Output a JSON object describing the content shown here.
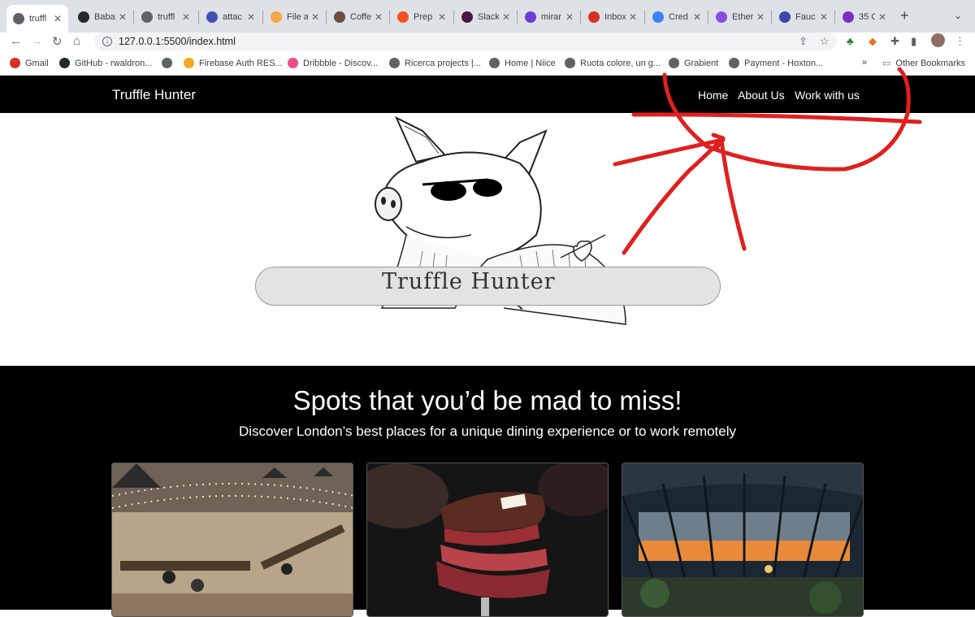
{
  "browser": {
    "tabs": [
      {
        "label": "truffl",
        "active": true,
        "color": "#5f6368"
      },
      {
        "label": "Baba",
        "color": "#24292e"
      },
      {
        "label": "truffl",
        "color": "#5f6368"
      },
      {
        "label": "attac",
        "color": "#3f51b5"
      },
      {
        "label": "File a",
        "color": "#f4a742"
      },
      {
        "label": "Coffe",
        "color": "#6d4c41"
      },
      {
        "label": "Prep",
        "color": "#f4511e"
      },
      {
        "label": "Slack",
        "color": "#4a154b"
      },
      {
        "label": "mirar",
        "color": "#6e3cd6"
      },
      {
        "label": "Inbox",
        "color": "#d93025"
      },
      {
        "label": "Cred",
        "color": "#3b82f6"
      },
      {
        "label": "Ether",
        "color": "#8a4ee6"
      },
      {
        "label": "Fauc",
        "color": "#3949ab"
      },
      {
        "label": "35 C",
        "color": "#7b2fbf"
      }
    ],
    "new_tab": "+",
    "url": "127.0.0.1:5500/index.html",
    "bookmarks": [
      {
        "label": "Gmail",
        "color": "#d93025"
      },
      {
        "label": "GitHub - rwaldron...",
        "color": "#24292e"
      },
      {
        "label": "",
        "color": "#5f6368"
      },
      {
        "label": "Firebase Auth RES...",
        "color": "#f6a623"
      },
      {
        "label": "Dribbble - Discov...",
        "color": "#ea4c89"
      },
      {
        "label": "Ricerca projects |...",
        "color": "#5f6368"
      },
      {
        "label": "Home | Niice",
        "color": "#5f6368"
      },
      {
        "label": "Ruota colore, un g...",
        "color": "#5f6368"
      },
      {
        "label": "Grabient",
        "color": "#5f6368"
      },
      {
        "label": "Payment - Hoxton...",
        "color": "#5f6368"
      }
    ],
    "bookmarks_overflow": "»",
    "other_bookmarks": "Other Bookmarks"
  },
  "site": {
    "brand": "Truffle Hunter",
    "nav": [
      "Home",
      "About Us",
      "Work with us"
    ],
    "hero_logo_text": "Truffle Hunter",
    "spots_title": "Spots that you’d be mad to miss!",
    "spots_subtitle": "Discover London’s best places for a unique dining experience or to work remotely"
  },
  "colors": {
    "nav_bg": "#000000",
    "annotation_red": "#e0201e"
  }
}
